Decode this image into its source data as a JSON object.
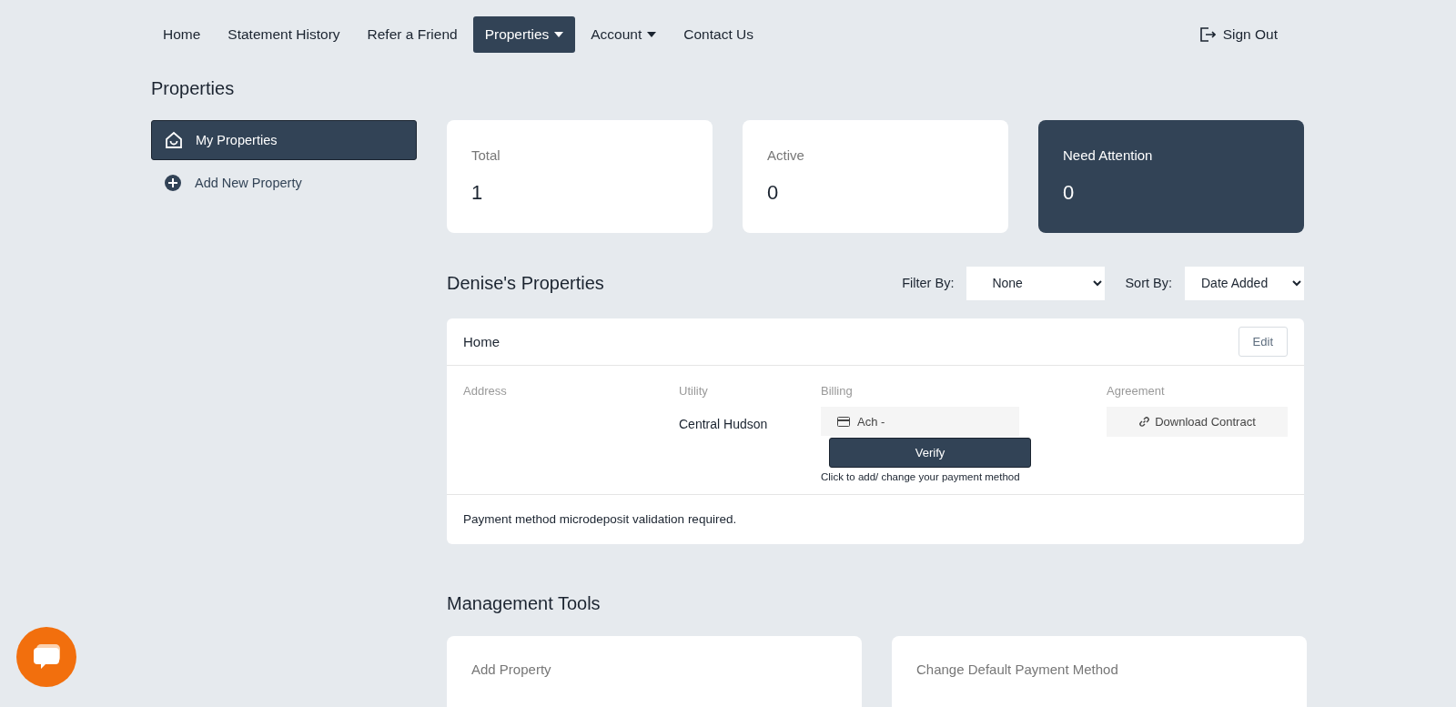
{
  "nav": {
    "items": [
      {
        "label": "Home",
        "selected": false,
        "dropdown": false
      },
      {
        "label": "Statement History",
        "selected": false,
        "dropdown": false
      },
      {
        "label": "Refer a Friend",
        "selected": false,
        "dropdown": false
      },
      {
        "label": "Properties",
        "selected": true,
        "dropdown": true
      },
      {
        "label": "Account",
        "selected": false,
        "dropdown": true
      },
      {
        "label": "Contact Us",
        "selected": false,
        "dropdown": false
      }
    ],
    "sign_out": "Sign Out"
  },
  "page_title": "Properties",
  "sidebar": {
    "items": [
      {
        "label": "My Properties",
        "selected": true
      },
      {
        "label": "Add New Property",
        "selected": false
      }
    ]
  },
  "stats": [
    {
      "label": "Total",
      "value": "1",
      "highlighted": false
    },
    {
      "label": "Active",
      "value": "0",
      "highlighted": false
    },
    {
      "label": "Need Attention",
      "value": "0",
      "highlighted": true
    }
  ],
  "properties_section": {
    "title": "Denise's Properties",
    "filter_label": "Filter By:",
    "filter_value": "None",
    "sort_label": "Sort By:",
    "sort_value": "Date Added"
  },
  "property": {
    "name": "Home",
    "edit": "Edit",
    "address_label": "Address",
    "utility_label": "Utility",
    "utility_value": "Central Hudson",
    "billing_label": "Billing",
    "billing_value": "Ach -",
    "verify": "Verify",
    "billing_hint": "Click to add/ change your payment method",
    "agreement_label": "Agreement",
    "download": "Download Contract",
    "notice": "Payment method microdeposit validation required."
  },
  "management_tools": {
    "title": "Management Tools",
    "cards": [
      "Add Property",
      "Change Default Payment Method"
    ]
  }
}
